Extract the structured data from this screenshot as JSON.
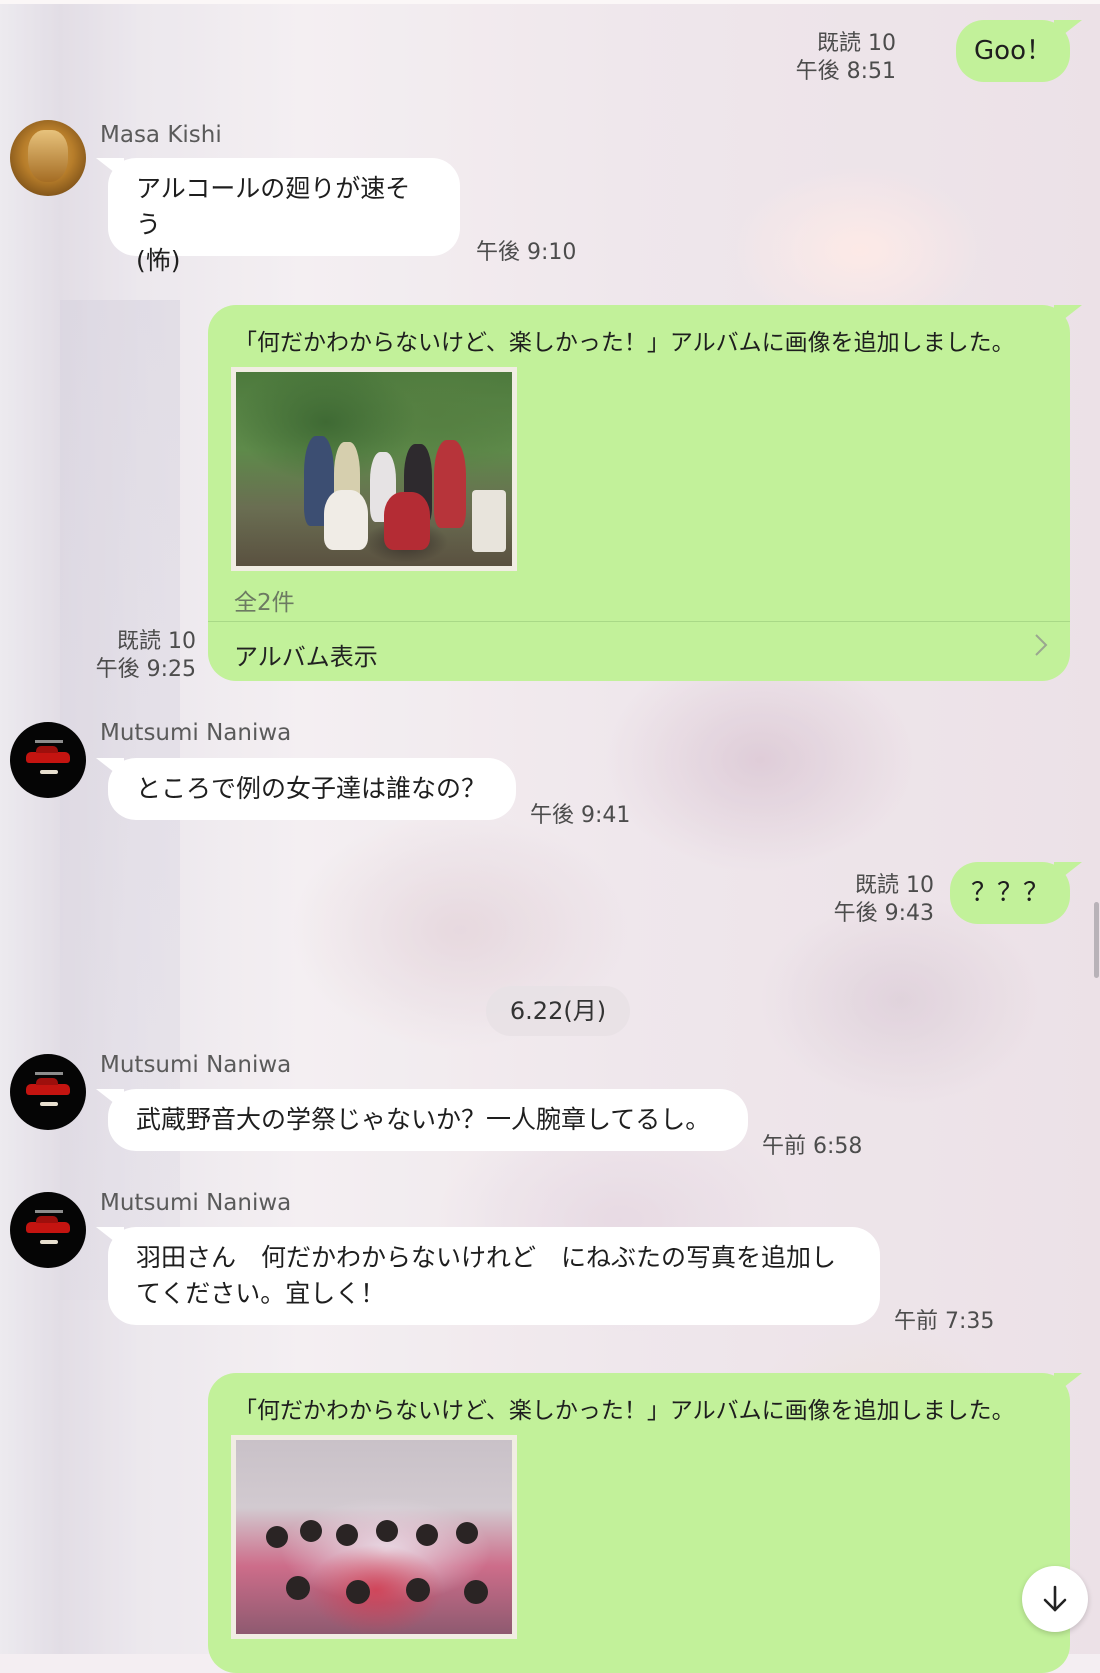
{
  "messages": {
    "m1": {
      "text": "Goo！",
      "read": "既読 10",
      "time": "午後 8:51"
    },
    "m2": {
      "sender": "Masa Kishi",
      "line1": "アルコールの廻りが速そう",
      "line2": "(怖)",
      "time": "午後 9:10"
    },
    "m3": {
      "title": "「何だかわからないけど、楽しかった！」アルバムに画像を追加しました。",
      "count": "全2件",
      "action": "アルバム表示",
      "read": "既読 10",
      "time": "午後 9:25"
    },
    "m4": {
      "sender": "Mutsumi Naniwa",
      "text": "ところで例の女子達は誰なの？",
      "time": "午後 9:41"
    },
    "m5": {
      "text": "？？？",
      "read": "既読 10",
      "time": "午後 9:43"
    },
    "date": "6.22(月)",
    "m6": {
      "sender": "Mutsumi Naniwa",
      "text": "武蔵野音大の学祭じゃないか？一人腕章してるし。",
      "time": "午前 6:58"
    },
    "m7": {
      "sender": "Mutsumi Naniwa",
      "line1": "羽田さん　何だかわからないけれど　にねぶたの写真を追加し",
      "line2": "てください。宜しく！",
      "time": "午前 7:35"
    },
    "m8": {
      "title": "「何だかわからないけど、楽しかった！」アルバムに画像を追加しました。"
    }
  },
  "icons": {
    "scroll_down": "arrow-down-icon",
    "chevron": "chevron-right-icon"
  },
  "colors": {
    "outgoing_bubble": "#c2f19a",
    "incoming_bubble": "#ffffff",
    "meta_text": "#4c4c4c"
  }
}
